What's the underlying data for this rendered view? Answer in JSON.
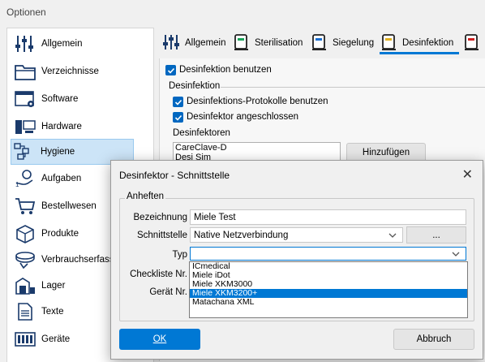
{
  "window": {
    "title": "Optionen"
  },
  "sidebar": {
    "items": [
      {
        "label": "Allgemein",
        "icon": "sliders-icon"
      },
      {
        "label": "Verzeichnisse",
        "icon": "folder-icon"
      },
      {
        "label": "Software",
        "icon": "software-window-icon"
      },
      {
        "label": "Hardware",
        "icon": "hardware-icon"
      },
      {
        "label": "Hygiene",
        "icon": "hygiene-icon",
        "selected": true
      },
      {
        "label": "Aufgaben",
        "icon": "tasks-icon"
      },
      {
        "label": "Bestellwesen",
        "icon": "cart-icon"
      },
      {
        "label": "Produkte",
        "icon": "product-box-icon"
      },
      {
        "label": "Verbrauchserfassung",
        "icon": "consumption-icon"
      },
      {
        "label": "Lager",
        "icon": "warehouse-icon"
      },
      {
        "label": "Texte",
        "icon": "text-document-icon"
      },
      {
        "label": "Geräte",
        "icon": "devices-icon"
      }
    ]
  },
  "tabs": [
    {
      "label": "Allgemein",
      "icon": "sliders-icon"
    },
    {
      "label": "Sterilisation",
      "icon": "sterilizer-icon"
    },
    {
      "label": "Siegelung",
      "icon": "sealer-icon"
    },
    {
      "label": "Desinfektion",
      "icon": "disinfector-icon",
      "active": true
    }
  ],
  "desinfektion": {
    "use_label": "Desinfektion benutzen",
    "group_label": "Desinfektion",
    "protocols_label": "Desinfektions-Protokolle benutzen",
    "connected_label": "Desinfektor angeschlossen",
    "list_label": "Desinfektoren",
    "list_items": [
      "CareClave-D",
      "Desi Sim"
    ],
    "add_button": "Hinzufügen"
  },
  "dialog": {
    "title": "Desinfektor - Schnittstelle",
    "group_label": "Anheften",
    "fields": {
      "bezeichnung_label": "Bezeichnung",
      "bezeichnung_value": "Miele Test",
      "schnittstelle_label": "Schnittstelle",
      "schnittstelle_value": "Native Netzverbindung",
      "schnittstelle_button": "...",
      "typ_label": "Typ",
      "typ_value": "",
      "checkliste_label": "Checkliste Nr.",
      "geraet_label": "Gerät Nr."
    },
    "typ_options": [
      "ICmedical",
      "Miele iDot",
      "Miele XKM3000",
      "Miele XKM3200+",
      "Matachana XML"
    ],
    "typ_selected_index": 3,
    "ok_button": "OK",
    "cancel_button": "Abbruch"
  },
  "colors": {
    "accent": "#0078d4",
    "selection": "#cce4f7"
  }
}
